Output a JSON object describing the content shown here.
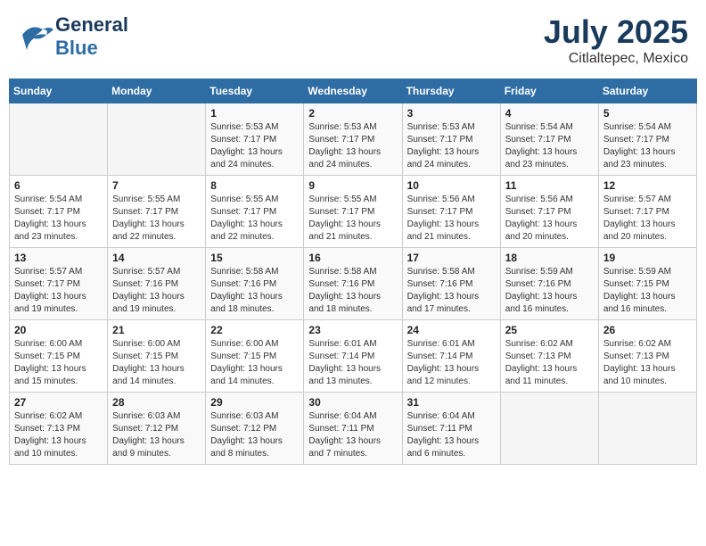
{
  "header": {
    "logo_general": "General",
    "logo_blue": "Blue",
    "title": "July 2025",
    "location": "Citlaltepec, Mexico"
  },
  "days_of_week": [
    "Sunday",
    "Monday",
    "Tuesday",
    "Wednesday",
    "Thursday",
    "Friday",
    "Saturday"
  ],
  "weeks": [
    [
      {
        "day": "",
        "empty": true
      },
      {
        "day": "",
        "empty": true
      },
      {
        "day": "1",
        "sunrise": "Sunrise: 5:53 AM",
        "sunset": "Sunset: 7:17 PM",
        "daylight": "Daylight: 13 hours and 24 minutes."
      },
      {
        "day": "2",
        "sunrise": "Sunrise: 5:53 AM",
        "sunset": "Sunset: 7:17 PM",
        "daylight": "Daylight: 13 hours and 24 minutes."
      },
      {
        "day": "3",
        "sunrise": "Sunrise: 5:53 AM",
        "sunset": "Sunset: 7:17 PM",
        "daylight": "Daylight: 13 hours and 24 minutes."
      },
      {
        "day": "4",
        "sunrise": "Sunrise: 5:54 AM",
        "sunset": "Sunset: 7:17 PM",
        "daylight": "Daylight: 13 hours and 23 minutes."
      },
      {
        "day": "5",
        "sunrise": "Sunrise: 5:54 AM",
        "sunset": "Sunset: 7:17 PM",
        "daylight": "Daylight: 13 hours and 23 minutes."
      }
    ],
    [
      {
        "day": "6",
        "sunrise": "Sunrise: 5:54 AM",
        "sunset": "Sunset: 7:17 PM",
        "daylight": "Daylight: 13 hours and 23 minutes."
      },
      {
        "day": "7",
        "sunrise": "Sunrise: 5:55 AM",
        "sunset": "Sunset: 7:17 PM",
        "daylight": "Daylight: 13 hours and 22 minutes."
      },
      {
        "day": "8",
        "sunrise": "Sunrise: 5:55 AM",
        "sunset": "Sunset: 7:17 PM",
        "daylight": "Daylight: 13 hours and 22 minutes."
      },
      {
        "day": "9",
        "sunrise": "Sunrise: 5:55 AM",
        "sunset": "Sunset: 7:17 PM",
        "daylight": "Daylight: 13 hours and 21 minutes."
      },
      {
        "day": "10",
        "sunrise": "Sunrise: 5:56 AM",
        "sunset": "Sunset: 7:17 PM",
        "daylight": "Daylight: 13 hours and 21 minutes."
      },
      {
        "day": "11",
        "sunrise": "Sunrise: 5:56 AM",
        "sunset": "Sunset: 7:17 PM",
        "daylight": "Daylight: 13 hours and 20 minutes."
      },
      {
        "day": "12",
        "sunrise": "Sunrise: 5:57 AM",
        "sunset": "Sunset: 7:17 PM",
        "daylight": "Daylight: 13 hours and 20 minutes."
      }
    ],
    [
      {
        "day": "13",
        "sunrise": "Sunrise: 5:57 AM",
        "sunset": "Sunset: 7:17 PM",
        "daylight": "Daylight: 13 hours and 19 minutes."
      },
      {
        "day": "14",
        "sunrise": "Sunrise: 5:57 AM",
        "sunset": "Sunset: 7:16 PM",
        "daylight": "Daylight: 13 hours and 19 minutes."
      },
      {
        "day": "15",
        "sunrise": "Sunrise: 5:58 AM",
        "sunset": "Sunset: 7:16 PM",
        "daylight": "Daylight: 13 hours and 18 minutes."
      },
      {
        "day": "16",
        "sunrise": "Sunrise: 5:58 AM",
        "sunset": "Sunset: 7:16 PM",
        "daylight": "Daylight: 13 hours and 18 minutes."
      },
      {
        "day": "17",
        "sunrise": "Sunrise: 5:58 AM",
        "sunset": "Sunset: 7:16 PM",
        "daylight": "Daylight: 13 hours and 17 minutes."
      },
      {
        "day": "18",
        "sunrise": "Sunrise: 5:59 AM",
        "sunset": "Sunset: 7:16 PM",
        "daylight": "Daylight: 13 hours and 16 minutes."
      },
      {
        "day": "19",
        "sunrise": "Sunrise: 5:59 AM",
        "sunset": "Sunset: 7:15 PM",
        "daylight": "Daylight: 13 hours and 16 minutes."
      }
    ],
    [
      {
        "day": "20",
        "sunrise": "Sunrise: 6:00 AM",
        "sunset": "Sunset: 7:15 PM",
        "daylight": "Daylight: 13 hours and 15 minutes."
      },
      {
        "day": "21",
        "sunrise": "Sunrise: 6:00 AM",
        "sunset": "Sunset: 7:15 PM",
        "daylight": "Daylight: 13 hours and 14 minutes."
      },
      {
        "day": "22",
        "sunrise": "Sunrise: 6:00 AM",
        "sunset": "Sunset: 7:15 PM",
        "daylight": "Daylight: 13 hours and 14 minutes."
      },
      {
        "day": "23",
        "sunrise": "Sunrise: 6:01 AM",
        "sunset": "Sunset: 7:14 PM",
        "daylight": "Daylight: 13 hours and 13 minutes."
      },
      {
        "day": "24",
        "sunrise": "Sunrise: 6:01 AM",
        "sunset": "Sunset: 7:14 PM",
        "daylight": "Daylight: 13 hours and 12 minutes."
      },
      {
        "day": "25",
        "sunrise": "Sunrise: 6:02 AM",
        "sunset": "Sunset: 7:13 PM",
        "daylight": "Daylight: 13 hours and 11 minutes."
      },
      {
        "day": "26",
        "sunrise": "Sunrise: 6:02 AM",
        "sunset": "Sunset: 7:13 PM",
        "daylight": "Daylight: 13 hours and 10 minutes."
      }
    ],
    [
      {
        "day": "27",
        "sunrise": "Sunrise: 6:02 AM",
        "sunset": "Sunset: 7:13 PM",
        "daylight": "Daylight: 13 hours and 10 minutes."
      },
      {
        "day": "28",
        "sunrise": "Sunrise: 6:03 AM",
        "sunset": "Sunset: 7:12 PM",
        "daylight": "Daylight: 13 hours and 9 minutes."
      },
      {
        "day": "29",
        "sunrise": "Sunrise: 6:03 AM",
        "sunset": "Sunset: 7:12 PM",
        "daylight": "Daylight: 13 hours and 8 minutes."
      },
      {
        "day": "30",
        "sunrise": "Sunrise: 6:04 AM",
        "sunset": "Sunset: 7:11 PM",
        "daylight": "Daylight: 13 hours and 7 minutes."
      },
      {
        "day": "31",
        "sunrise": "Sunrise: 6:04 AM",
        "sunset": "Sunset: 7:11 PM",
        "daylight": "Daylight: 13 hours and 6 minutes."
      },
      {
        "day": "",
        "empty": true
      },
      {
        "day": "",
        "empty": true
      }
    ]
  ]
}
